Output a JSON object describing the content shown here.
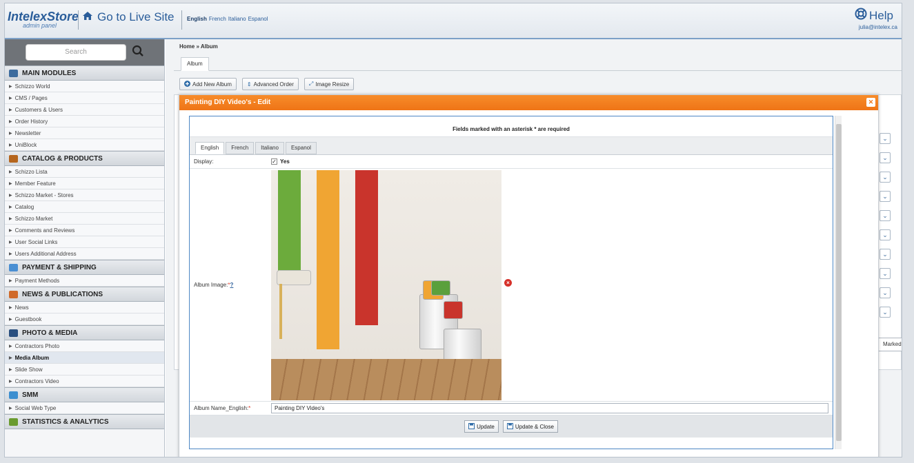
{
  "header": {
    "logo": "IntelexStore",
    "logo_sub": "admin panel",
    "live_site": "Go to Live Site",
    "languages": [
      "English",
      "French",
      "Italiano",
      "Espanol"
    ],
    "help": "Help",
    "user": "julia@intelex.ca"
  },
  "sidebar": {
    "search_placeholder": "Search",
    "sections": [
      {
        "title": "MAIN MODULES",
        "items": [
          "Schizzo World",
          "CMS / Pages",
          "Customers & Users",
          "Order History",
          "Newsletter",
          "UniBlock"
        ]
      },
      {
        "title": "CATALOG & PRODUCTS",
        "items": [
          "Schizzo Lista",
          "Member Feature",
          "Schizzo Market - Stores",
          "Catalog",
          "Schizzo Market",
          "Comments and Reviews",
          "User Social Links",
          "Users Additional Address"
        ]
      },
      {
        "title": "PAYMENT & SHIPPING",
        "items": [
          "Payment Methods"
        ]
      },
      {
        "title": "NEWS & PUBLICATIONS",
        "items": [
          "News",
          "Guestbook"
        ]
      },
      {
        "title": "PHOTO & MEDIA",
        "items": [
          "Contractors Photo",
          "Media Album",
          "Slide Show",
          "Contractors Video"
        ]
      },
      {
        "title": "SMM",
        "items": [
          "Social Web Type"
        ]
      },
      {
        "title": "STATISTICS & ANALYTICS",
        "items": []
      }
    ],
    "active_item": "Media Album"
  },
  "main": {
    "breadcrumb": "Home » Album",
    "tab": "Album",
    "toolbar": {
      "add": "Add New Album",
      "order": "Advanced Order",
      "resize": "Image Resize"
    },
    "marked": "Marked"
  },
  "modal": {
    "title": "Painting DIY Video's - Edit",
    "required_note": "Fields marked with an asterisk * are required",
    "tabs": [
      "English",
      "French",
      "Italiano",
      "Espanol"
    ],
    "display_label": "Display:",
    "display_value": "Yes",
    "image_label": "Album Image:",
    "image_help": "?",
    "name_label": "Album Name_English:",
    "name_value": "Painting DIY Video's",
    "update": "Update",
    "update_close": "Update & Close"
  }
}
